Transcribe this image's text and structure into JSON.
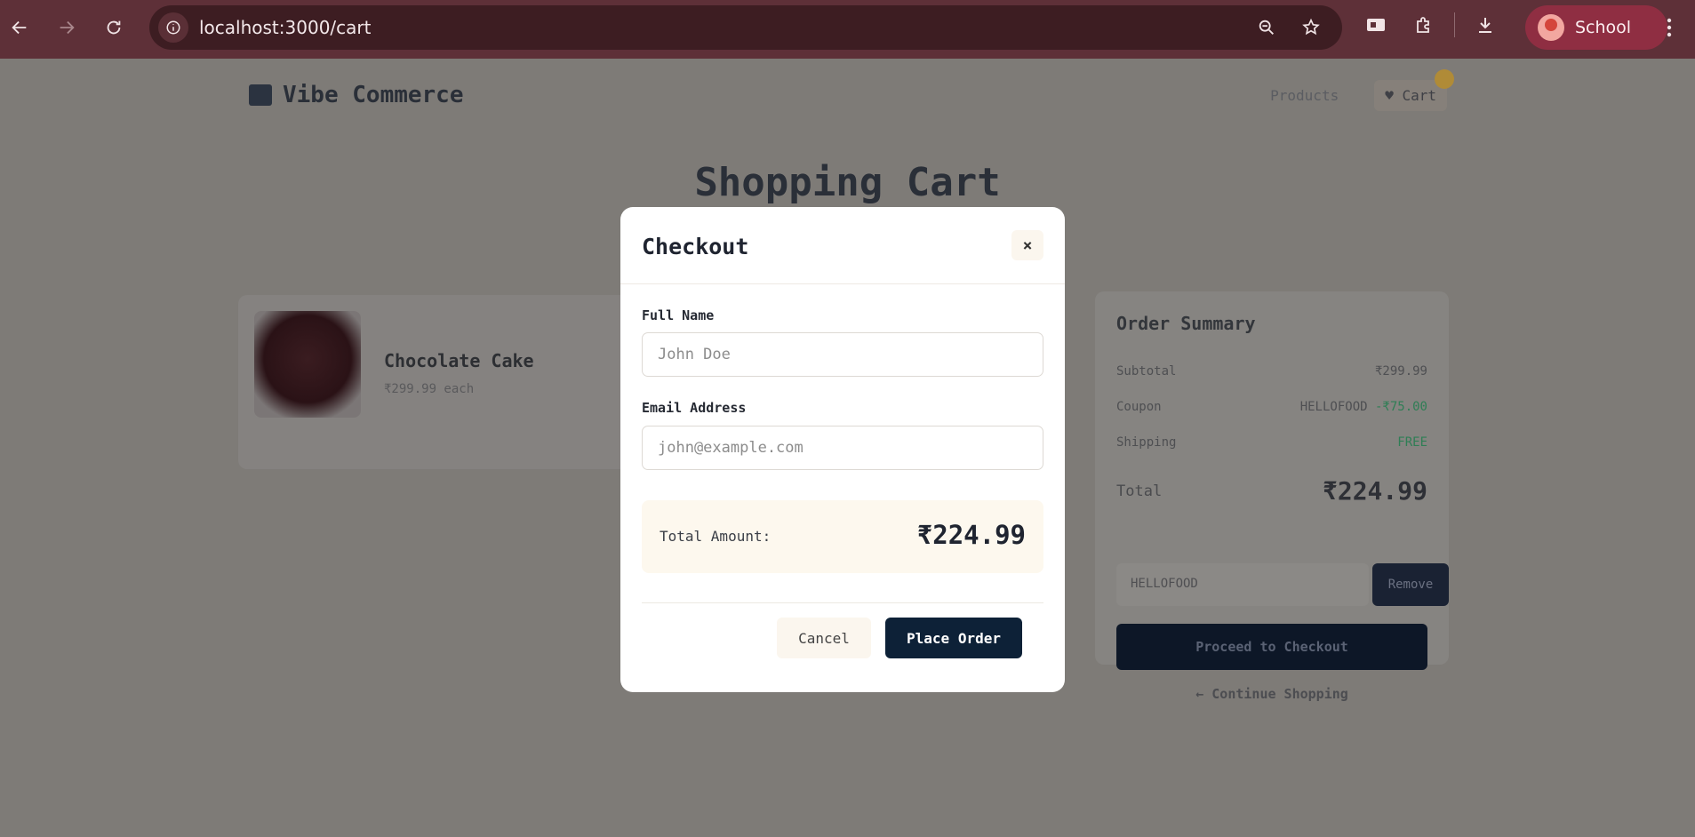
{
  "browser": {
    "url": "localhost:3000/cart",
    "profile_label": "School",
    "icons": [
      "back-arrow-icon",
      "forward-arrow-icon",
      "reload-icon",
      "site-info-icon",
      "zoom-icon",
      "bookmark-star-icon",
      "extension-icon",
      "puzzle-icon",
      "download-icon",
      "more-menu-icon"
    ]
  },
  "site": {
    "brand_name": "Vibe Commerce",
    "nav_products": "Products",
    "nav_cart": "Cart",
    "page_title": "Shopping Cart"
  },
  "cart_item": {
    "name": "Chocolate Cake",
    "price": "₹299.99 each"
  },
  "summary": {
    "title": "Order Summary",
    "subtotal_label": "Subtotal",
    "subtotal_value": "₹299.99",
    "coupon_label": "Coupon",
    "coupon_code": "HELLOFOOD",
    "coupon_discount": "-₹75.00",
    "shipping_label": "Shipping",
    "shipping_value": "FREE",
    "total_label": "Total",
    "total_value": "₹224.99",
    "coupon_input_value": "HELLOFOOD",
    "remove_label": "Remove",
    "checkout_label": "Proceed to Checkout",
    "continue_label": "← Continue Shopping"
  },
  "modal": {
    "title": "Checkout",
    "close_glyph": "×",
    "name_label": "Full Name",
    "name_placeholder": "John Doe",
    "email_label": "Email Address",
    "email_placeholder": "john@example.com",
    "total_label": "Total Amount:",
    "total_value": "₹224.99",
    "cancel_label": "Cancel",
    "place_order_label": "Place Order"
  },
  "colors": {
    "chrome_bg": "#5e3038",
    "overlay": "#7e7b77",
    "primary_button": "#0d2137",
    "total_box_bg": "#fdf8ee",
    "profile_bg": "#8f2e42"
  }
}
